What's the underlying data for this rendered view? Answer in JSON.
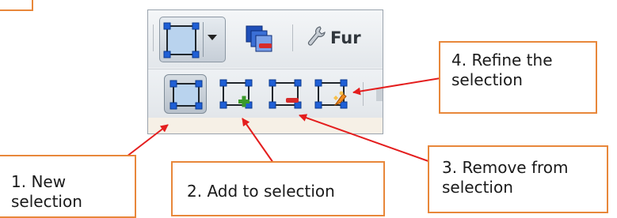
{
  "toolbar": {
    "function_label": "Fur",
    "mode_dropdown_icon": "new-selection-icon",
    "tools": [
      {
        "name": "new-selection",
        "icon": "new-selection-icon",
        "active": true
      },
      {
        "name": "add-to-selection",
        "icon": "add-selection-icon",
        "active": false
      },
      {
        "name": "remove-from-selection",
        "icon": "remove-selection-icon",
        "active": false
      },
      {
        "name": "refine-selection",
        "icon": "refine-selection-icon",
        "active": false
      }
    ]
  },
  "callouts": {
    "new_selection": "1. New selection",
    "add_selection": "2. Add to selection",
    "remove_selection": "3. Remove from selection",
    "refine_selection": "4. Refine the selection"
  },
  "colors": {
    "callout_border": "#e8873a",
    "arrow": "#e41e1e",
    "handle_blue": "#1f5fd6",
    "add_green": "#3a9a2a",
    "remove_red": "#d62b2b",
    "refine_orange": "#f08a1c"
  }
}
